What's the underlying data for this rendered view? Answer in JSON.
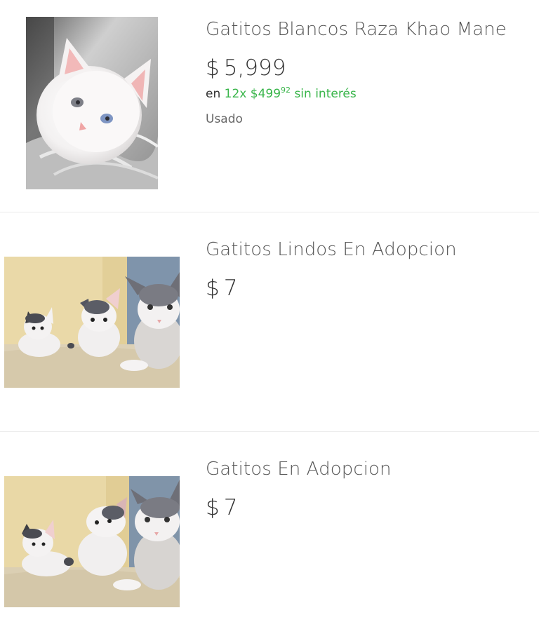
{
  "results": [
    {
      "image_alt": "white kitten photo",
      "title": "Gatitos Blancos Raza Khao Mane",
      "currency": "$",
      "price": "5,999",
      "installments": {
        "prefix": "en",
        "count": "12x",
        "currency": "$",
        "amount": "499",
        "cents": "92",
        "suffix": "sin interés"
      },
      "condition": "Usado"
    },
    {
      "image_alt": "three kittens photo",
      "title": "Gatitos Lindos En Adopcion",
      "currency": "$",
      "price": "7"
    },
    {
      "image_alt": "three kittens photo",
      "title": "Gatitos En Adopcion",
      "currency": "$",
      "price": "7"
    }
  ],
  "colors": {
    "installments_green": "#39b54a",
    "title_gray": "#555555",
    "price_dark": "#333333",
    "divider": "#ececec"
  }
}
